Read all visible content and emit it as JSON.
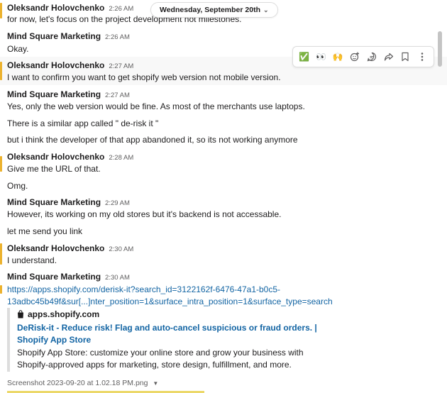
{
  "date_divider": {
    "label": "Wednesday, September 20th"
  },
  "messages": [
    {
      "author": "Oleksandr Holovchenko",
      "time": "2:26 AM",
      "lines": [
        "for now, let's focus on the project development not milestones."
      ]
    },
    {
      "author": "Mind Square Marketing",
      "time": "2:26 AM",
      "lines": [
        "Okay."
      ]
    },
    {
      "author": "Oleksandr Holovchenko",
      "time": "2:27 AM",
      "lines": [
        "I want to confirm you want to get shopify web version not mobile version."
      ]
    },
    {
      "author": "Mind Square Marketing",
      "time": "2:27 AM",
      "lines": [
        "Yes, only the web version would be fine. As most of the merchants use laptops.",
        "There is a similar app called \" de-risk it \"",
        "but i think the developer of that app abandoned it, so its not working anymore"
      ]
    },
    {
      "author": "Oleksandr Holovchenko",
      "time": "2:28 AM",
      "lines": [
        "Give me the URL of that.",
        "Omg."
      ]
    },
    {
      "author": "Mind Square Marketing",
      "time": "2:29 AM",
      "lines": [
        "However, its working on my old stores but it's backend is not accessable.",
        "let me send you link"
      ]
    },
    {
      "author": "Oleksandr Holovchenko",
      "time": "2:30 AM",
      "lines": [
        "I understand."
      ]
    },
    {
      "author": "Mind Square Marketing",
      "time": "2:30 AM",
      "lines": [
        "https://apps.shopify.com/derisk-it?search_id=3122162f-6476-47a1-b0c5-",
        "13adbc45b49f&sur[...]nter_position=1&surface_intra_position=1&surface_type=search"
      ]
    }
  ],
  "link_preview": {
    "site": "apps.shopify.com",
    "title": "DeRisk-it - Reduce risk! Flag and auto-cancel suspicious or fraud orders. | Shopify App Store",
    "description": "Shopify App Store: customize your online store and grow your business with Shopify-approved apps for marketing, store design, fulfillment, and more."
  },
  "attachment": {
    "label": "Screenshot 2023-09-20 at 1.02.18 PM.png"
  },
  "toolbar": {
    "reactions": [
      "✅",
      "👀",
      "🙌"
    ],
    "icons": [
      "add-reaction-icon",
      "reply-thread-icon",
      "forward-icon",
      "bookmark-icon",
      "more-actions-icon"
    ]
  },
  "colors": {
    "link": "#1264a3",
    "edge": "#ecb22e",
    "text": "#1d1c1d",
    "muted": "#616061"
  }
}
